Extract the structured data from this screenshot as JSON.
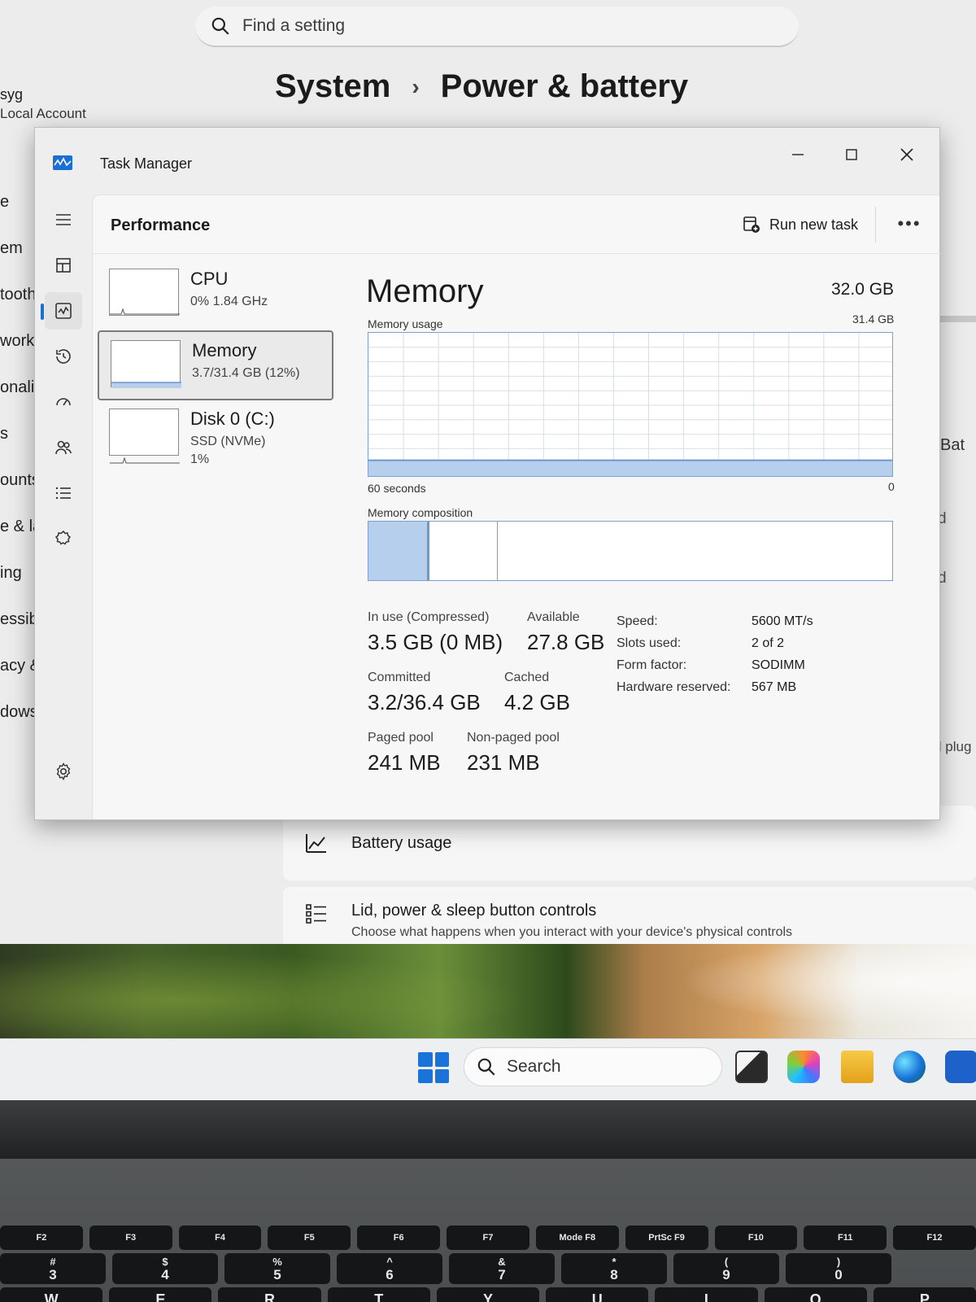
{
  "settings": {
    "search_placeholder": "Find a setting",
    "account_name": "syg",
    "account_type": "Local Account",
    "breadcrumb_parent": "System",
    "breadcrumb_sep": "›",
    "breadcrumb_current": "Power & battery",
    "nav_items": [
      "e",
      "em",
      "tooth",
      "work",
      "onali",
      "s",
      "ounts",
      "e & la",
      "ing",
      "essibi",
      "acy &",
      "dows"
    ],
    "right_edge_text": "Bat",
    "right_d1": "d",
    "right_d2": "d",
    "right_plug": "il plug",
    "battery_usage": "Battery usage",
    "lid_title": "Lid, power & sleep button controls",
    "lid_sub": "Choose what happens when you interact with your device's physical controls"
  },
  "task_manager": {
    "title": "Task Manager",
    "page_title": "Performance",
    "run_new_task": "Run new task",
    "more": "•••",
    "devices": [
      {
        "name": "CPU",
        "sub1": "0%  1.84 GHz",
        "sub2": ""
      },
      {
        "name": "Memory",
        "sub1": "3.7/31.4 GB (12%)",
        "sub2": ""
      },
      {
        "name": "Disk 0 (C:)",
        "sub1": "SSD (NVMe)",
        "sub2": "1%"
      }
    ],
    "memory": {
      "title": "Memory",
      "total": "32.0 GB",
      "usage_label": "Memory usage",
      "usage_max": "31.4 GB",
      "time_label": "60 seconds",
      "zero_label": "0",
      "usage_fraction": 0.12,
      "composition_label": "Memory composition",
      "composition": {
        "in_use_fraction": 0.117,
        "modified_fraction": 0.13
      },
      "in_use_label": "In use (Compressed)",
      "in_use_value": "3.5 GB (0 MB)",
      "available_label": "Available",
      "available_value": "27.8 GB",
      "committed_label": "Committed",
      "committed_value": "3.2/36.4 GB",
      "cached_label": "Cached",
      "cached_value": "4.2 GB",
      "paged_label": "Paged pool",
      "paged_value": "241 MB",
      "nonpaged_label": "Non-paged pool",
      "nonpaged_value": "231 MB",
      "specs": [
        {
          "k": "Speed:",
          "v": "5600 MT/s"
        },
        {
          "k": "Slots used:",
          "v": "2 of 2"
        },
        {
          "k": "Form factor:",
          "v": "SODIMM"
        },
        {
          "k": "Hardware reserved:",
          "v": "567 MB"
        }
      ]
    }
  },
  "taskbar": {
    "search_placeholder": "Search",
    "apps": [
      "tv-app-icon",
      "copilot-icon",
      "file-explorer-icon",
      "edge-icon",
      "store-icon"
    ]
  },
  "keyboard": {
    "fn_row": [
      "F2",
      "F3",
      "F4",
      "F5",
      "F6",
      "F7",
      "Mode F8",
      "PrtSc F9",
      "F10",
      "F11",
      "F12"
    ],
    "num_row": [
      {
        "top": "#",
        "bottom": "3"
      },
      {
        "top": "$",
        "bottom": "4"
      },
      {
        "top": "%",
        "bottom": "5"
      },
      {
        "top": "^",
        "bottom": "6"
      },
      {
        "top": "&",
        "bottom": "7"
      },
      {
        "top": "*",
        "bottom": "8"
      },
      {
        "top": "(",
        "bottom": "9"
      },
      {
        "top": ")",
        "bottom": "0"
      }
    ],
    "letter_row": [
      "W",
      "E",
      "R",
      "T",
      "Y",
      "U",
      "I",
      "O",
      "P"
    ]
  },
  "colors": {
    "accent": "#1a6fd6",
    "graph_fill": "#b5cfec",
    "graph_line": "#6d97cd"
  }
}
